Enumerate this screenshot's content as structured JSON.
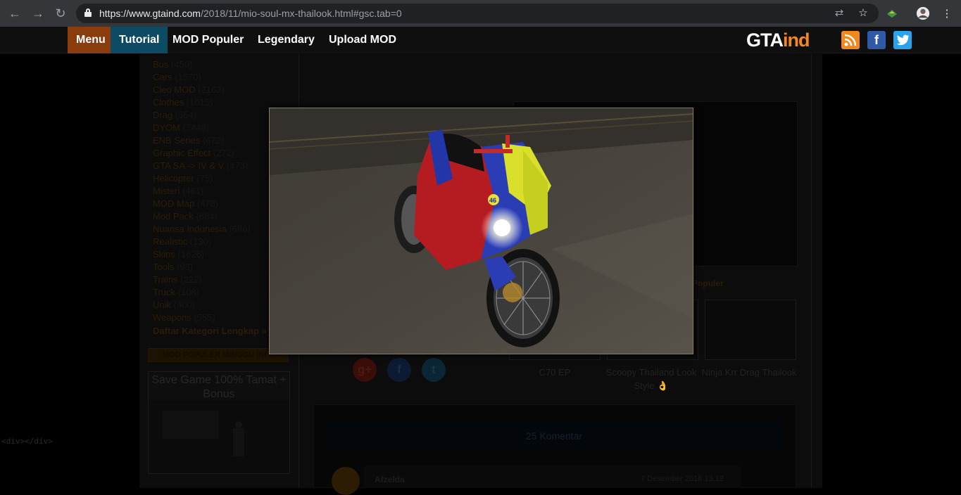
{
  "browser": {
    "url_host": "https://www.gtaind.com",
    "url_path": "/2018/11/mio-soul-mx-thailook.html#gsc.tab=0",
    "back_icon": "←",
    "forward_icon": "→",
    "reload_icon": "↻",
    "translate_icon": "⇄",
    "star_icon": "☆",
    "menu_icon": "⋮"
  },
  "header": {
    "nav": [
      "Menu",
      "Tutorial",
      "MOD Populer",
      "Legendary",
      "Upload MOD"
    ],
    "logo_gta": "GTA",
    "logo_ind": "ind",
    "rss": "⌇",
    "facebook": "f",
    "twitter": "t",
    "colors": {
      "menu_bg": "#8b3c0c",
      "tutorial_bg": "#0d4a63"
    }
  },
  "sidebar": {
    "categories": [
      {
        "name": "Bus",
        "count": "(450)"
      },
      {
        "name": "Cars",
        "count": "(1570)"
      },
      {
        "name": "Cleo MOD",
        "count": "(2162)"
      },
      {
        "name": "Clothes",
        "count": "(1015)"
      },
      {
        "name": "Drag",
        "count": "(554)"
      },
      {
        "name": "DYOM",
        "count": "(7448)"
      },
      {
        "name": "ENB Series",
        "count": "(672)"
      },
      {
        "name": "Graphic Effect",
        "count": "(272)"
      },
      {
        "name": "GTA SA -> IV & V",
        "count": "(473)"
      },
      {
        "name": "Helicopter",
        "count": "(75)"
      },
      {
        "name": "Misteri",
        "count": "(461)"
      },
      {
        "name": "MOD Map",
        "count": "(478)"
      },
      {
        "name": "Mod Pack",
        "count": "(684)"
      },
      {
        "name": "Nuansa Indonesia",
        "count": "(686)"
      },
      {
        "name": "Realistic",
        "count": "(130)"
      },
      {
        "name": "Skins",
        "count": "(1626)"
      },
      {
        "name": "Tools",
        "count": "(93)"
      },
      {
        "name": "Trains",
        "count": "(222)"
      },
      {
        "name": "Truck",
        "count": "(108)"
      },
      {
        "name": "Unik",
        "count": "(400)"
      },
      {
        "name": "Weapons",
        "count": "(555)"
      }
    ],
    "more_link": "Daftar Kategori Lengkap »",
    "popular_heading": "MOD POPULER MINGGU INI",
    "popular_title": "Save Game 100% Tamat + Bonus"
  },
  "content": {
    "tabs_text": "ary | Populer",
    "related": [
      {
        "label": "C70 EP"
      },
      {
        "label": "Scoopy Thailand Look Style 👌"
      },
      {
        "label": "Ninja Krr Drag Thailook"
      }
    ],
    "share": {
      "google": "g+",
      "facebook": "f",
      "twitter": "t"
    },
    "comments_count": "25 Komentar",
    "commenter": "Afzelda",
    "comment_date": "7 Desember 2018 13.12"
  },
  "dev_text": "<div></div>"
}
